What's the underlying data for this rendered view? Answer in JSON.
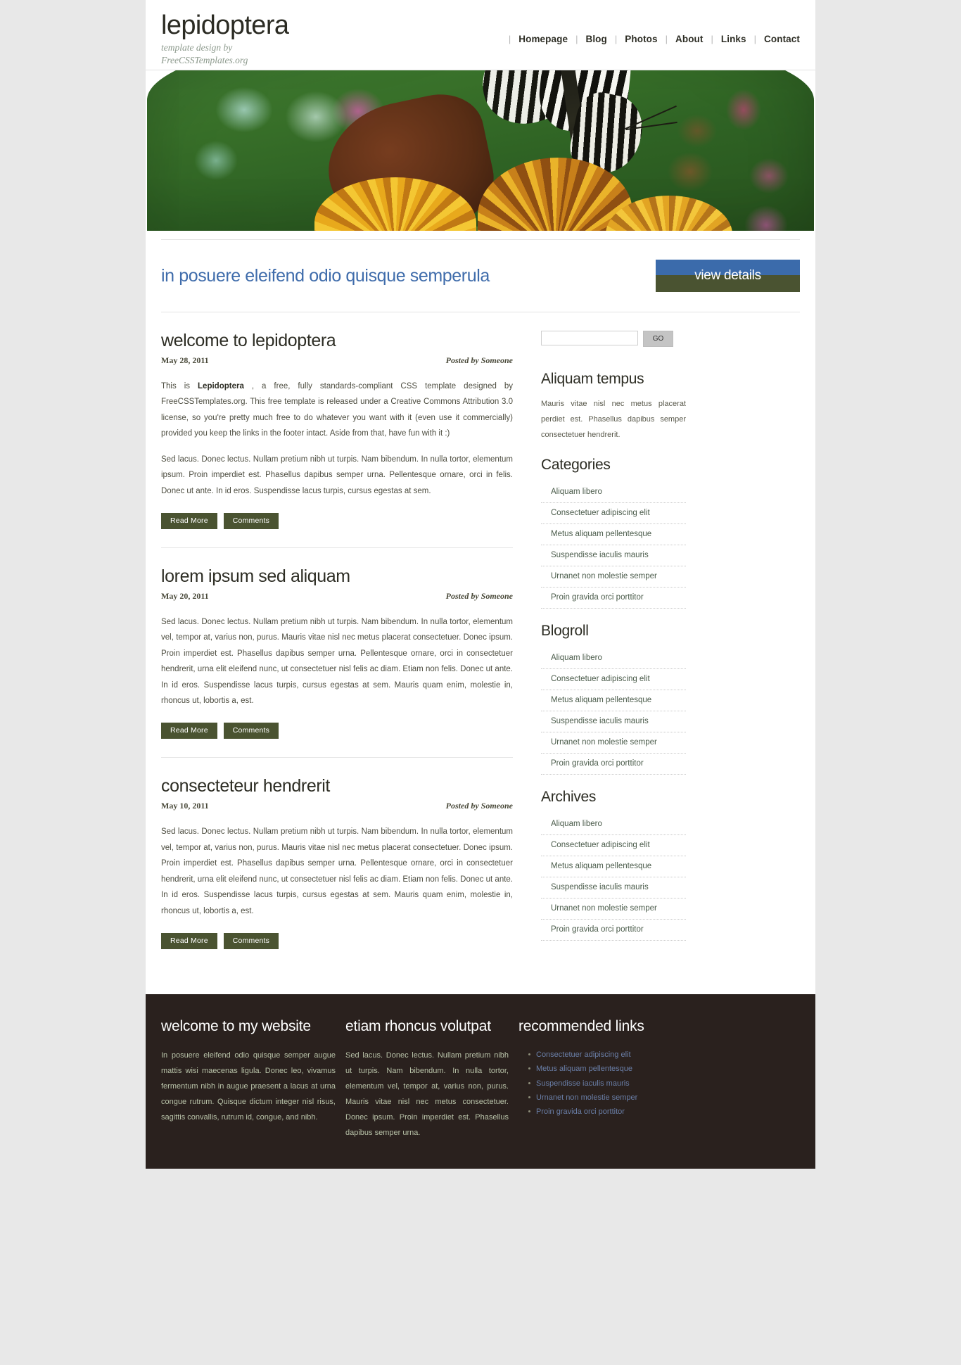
{
  "site": {
    "logo_title": "lepidoptera",
    "tagline_line1": "template design by",
    "tagline_line2": "FreeCSSTemplates.org"
  },
  "menu": {
    "items": [
      {
        "label": "Homepage"
      },
      {
        "label": "Blog"
      },
      {
        "label": "Photos"
      },
      {
        "label": "About"
      },
      {
        "label": "Links"
      },
      {
        "label": "Contact"
      }
    ],
    "separator": "|"
  },
  "splash": {
    "headline": "in posuere eleifend odio quisque semperula",
    "button_label": "view details"
  },
  "posts": [
    {
      "title": "welcome to lepidoptera",
      "date": "May 28, 2011",
      "author": "Posted by Someone",
      "body1_pre": "This is ",
      "body1_strong": "Lepidoptera",
      "body1_post": " , a free, fully standards-compliant CSS template designed by FreeCSSTemplates.org. This free template is released under a Creative Commons Attribution 3.0 license, so you're pretty much free to do whatever you want with it (even use it commercially) provided you keep the links in the footer intact. Aside from that, have fun with it :)",
      "body2": "Sed lacus. Donec lectus. Nullam pretium nibh ut turpis. Nam bibendum. In nulla tortor, elementum ipsum. Proin imperdiet est. Phasellus dapibus semper urna. Pellentesque ornare, orci in felis. Donec ut ante. In id eros. Suspendisse lacus turpis, cursus egestas at sem.",
      "read_more": "Read More",
      "comments": "Comments"
    },
    {
      "title": "lorem ipsum sed aliquam",
      "date": "May 20, 2011",
      "author": "Posted by Someone",
      "body2": "Sed lacus. Donec lectus. Nullam pretium nibh ut turpis. Nam bibendum. In nulla tortor, elementum vel, tempor at, varius non, purus. Mauris vitae nisl nec metus placerat consectetuer. Donec ipsum. Proin imperdiet est. Phasellus dapibus semper urna. Pellentesque ornare, orci in consectetuer hendrerit, urna elit eleifend nunc, ut consectetuer nisl felis ac diam. Etiam non felis. Donec ut ante. In id eros. Suspendisse lacus turpis, cursus egestas at sem. Mauris quam enim, molestie in, rhoncus ut, lobortis a, est.",
      "read_more": "Read More",
      "comments": "Comments"
    },
    {
      "title": "consecteteur hendrerit",
      "date": "May 10, 2011",
      "author": "Posted by Someone",
      "body2": "Sed lacus. Donec lectus. Nullam pretium nibh ut turpis. Nam bibendum. In nulla tortor, elementum vel, tempor at, varius non, purus. Mauris vitae nisl nec metus placerat consectetuer. Donec ipsum. Proin imperdiet est. Phasellus dapibus semper urna. Pellentesque ornare, orci in consectetuer hendrerit, urna elit eleifend nunc, ut consectetuer nisl felis ac diam. Etiam non felis. Donec ut ante. In id eros. Suspendisse lacus turpis, cursus egestas at sem. Mauris quam enim, molestie in, rhoncus ut, lobortis a, est.",
      "read_more": "Read More",
      "comments": "Comments"
    }
  ],
  "sidebar": {
    "search": {
      "value": "",
      "placeholder": "",
      "go_label": "GO"
    },
    "aliquam": {
      "heading": "Aliquam tempus",
      "text": "Mauris vitae nisl nec metus placerat perdiet est. Phasellus dapibus semper consectetuer hendrerit."
    },
    "categories": {
      "heading": "Categories",
      "items": [
        {
          "label": "Aliquam libero"
        },
        {
          "label": "Consectetuer adipiscing elit"
        },
        {
          "label": "Metus aliquam pellentesque"
        },
        {
          "label": "Suspendisse iaculis mauris"
        },
        {
          "label": "Urnanet non molestie semper"
        },
        {
          "label": "Proin gravida orci porttitor"
        }
      ]
    },
    "blogroll": {
      "heading": "Blogroll",
      "items": [
        {
          "label": "Aliquam libero"
        },
        {
          "label": "Consectetuer adipiscing elit"
        },
        {
          "label": "Metus aliquam pellentesque"
        },
        {
          "label": "Suspendisse iaculis mauris"
        },
        {
          "label": "Urnanet non molestie semper"
        },
        {
          "label": "Proin gravida orci porttitor"
        }
      ]
    },
    "archives": {
      "heading": "Archives",
      "items": [
        {
          "label": "Aliquam libero"
        },
        {
          "label": "Consectetuer adipiscing elit"
        },
        {
          "label": "Metus aliquam pellentesque"
        },
        {
          "label": "Suspendisse iaculis mauris"
        },
        {
          "label": "Urnanet non molestie semper"
        },
        {
          "label": "Proin gravida orci porttitor"
        }
      ]
    }
  },
  "footer": {
    "col1": {
      "heading": "welcome to my website",
      "text": "In posuere eleifend odio quisque semper augue mattis wisi maecenas ligula. Donec leo, vivamus fermentum nibh in augue praesent a lacus at urna congue rutrum. Quisque dictum integer nisl risus, sagittis convallis, rutrum id, congue, and nibh."
    },
    "col2": {
      "heading": "etiam rhoncus volutpat",
      "text": "Sed lacus. Donec lectus. Nullam pretium nibh ut turpis. Nam bibendum. In nulla tortor, elementum vel, tempor at, varius non, purus. Mauris vitae nisl nec metus consectetuer. Donec ipsum. Proin imperdiet est. Phasellus dapibus semper urna."
    },
    "col3": {
      "heading": "recommended links",
      "items": [
        {
          "label": "Consectetuer adipiscing elit"
        },
        {
          "label": "Metus aliquam pellentesque"
        },
        {
          "label": "Suspendisse iaculis mauris"
        },
        {
          "label": "Urnanet non molestie semper"
        },
        {
          "label": "Proin gravida orci porttitor"
        }
      ]
    }
  },
  "colors": {
    "accent_blue": "#3b6bab",
    "olive": "#4a5331",
    "footer_bg": "#2a211e",
    "page_bg": "#e8e8e8"
  }
}
